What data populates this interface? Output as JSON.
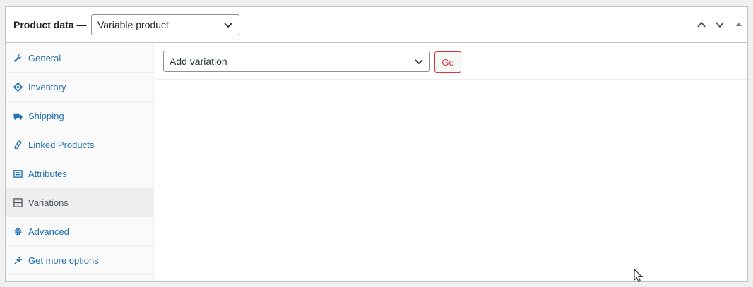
{
  "header": {
    "title": "Product data —",
    "product_type": "Variable product"
  },
  "tabs": [
    {
      "label": "General",
      "icon": "wrench-icon"
    },
    {
      "label": "Inventory",
      "icon": "tag-icon"
    },
    {
      "label": "Shipping",
      "icon": "truck-icon"
    },
    {
      "label": "Linked Products",
      "icon": "link-icon"
    },
    {
      "label": "Attributes",
      "icon": "list-icon"
    },
    {
      "label": "Variations",
      "icon": "grid-icon",
      "active": true
    },
    {
      "label": "Advanced",
      "icon": "gear-icon"
    },
    {
      "label": "Get more options",
      "icon": "plugin-icon"
    }
  ],
  "toolbar": {
    "variation_action": "Add variation",
    "go_label": "Go"
  },
  "colors": {
    "link": "#2271b1",
    "active_text": "#50575e",
    "danger": "#d63638",
    "border": "#c3c4c7"
  }
}
